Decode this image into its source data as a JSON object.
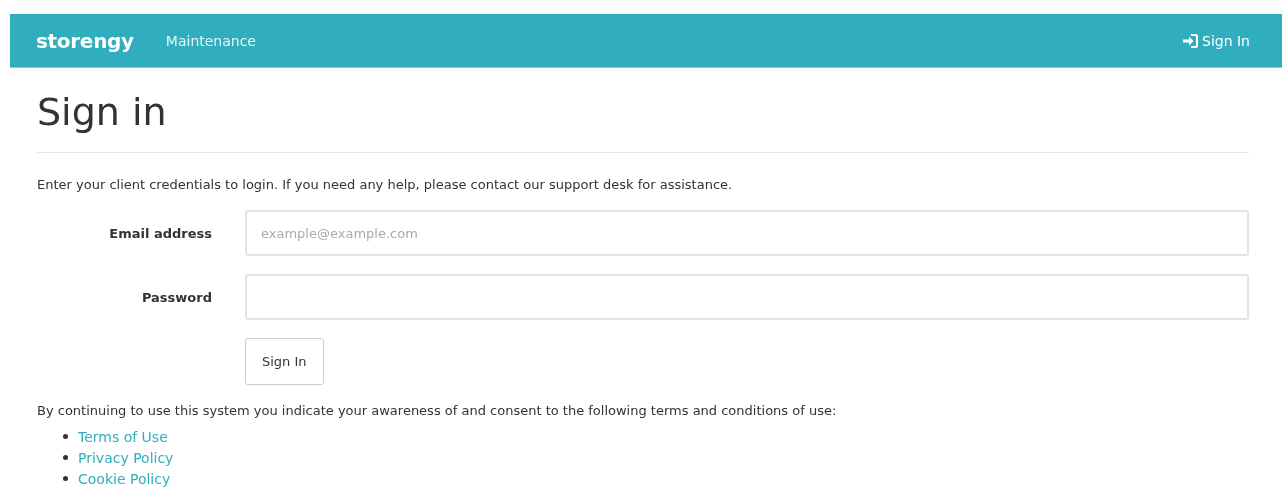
{
  "navbar": {
    "brand": "storengy",
    "links": [
      "Maintenance"
    ],
    "sign_in": "Sign In"
  },
  "heading": "Sign in",
  "intro": "Enter your client credentials to login. If you need any help, please contact our support desk for assistance.",
  "form": {
    "fields": [
      {
        "label": "Email address",
        "placeholder": "example@example.com"
      },
      {
        "label": "Password"
      }
    ],
    "submit": "Sign In"
  },
  "terms_text": "By continuing to use this system you indicate your awareness of and consent to the following terms and conditions of use:",
  "terms_links": [
    "Terms of Use",
    "Privacy Policy",
    "Cookie Policy"
  ]
}
